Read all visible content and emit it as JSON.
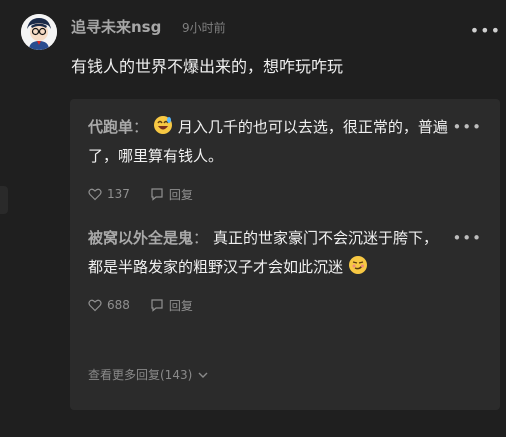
{
  "comment": {
    "author": "追寻未来nsg",
    "time": "9小时前",
    "text": "有钱人的世界不爆出来的，想咋玩咋玩"
  },
  "replies": [
    {
      "author": "代跑单",
      "text_before_emoji": "",
      "emoji": "grinning-sweat-emoji",
      "text": "月入几千的也可以去选，很正常的，普遍了，哪里算有钱人。",
      "likes": "137",
      "reply_label": "回复"
    },
    {
      "author": "被窝以外全是鬼",
      "text": "真正的世家豪门不会沉迷于胯下，都是半路发家的粗野汉子才会如此沉迷",
      "emoji": "smirk-emoji",
      "likes": "688",
      "reply_label": "回复"
    }
  ],
  "view_more": "查看更多回复(143)",
  "colors": {
    "background": "#1f1f1f",
    "reply_box": "#2b2b2b",
    "author": "#a9a9a9",
    "text": "#f0f0f0",
    "muted": "#909090"
  }
}
